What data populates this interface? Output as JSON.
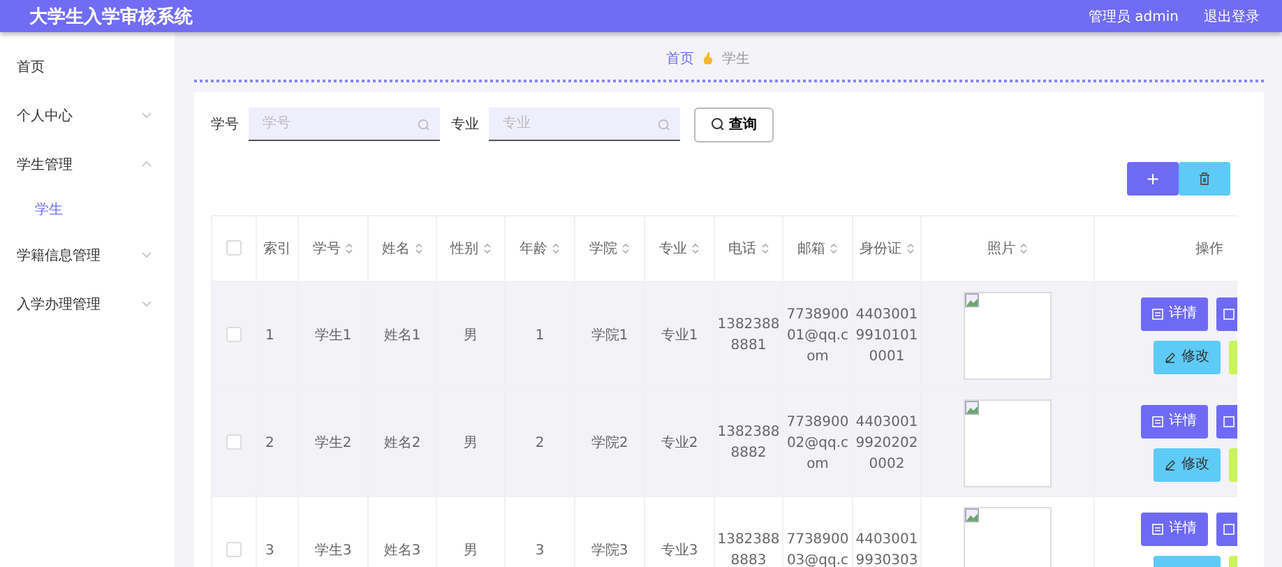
{
  "header": {
    "title": "大学生入学审核系统",
    "user": "管理员 admin",
    "logout": "退出登录"
  },
  "sidebar": {
    "items": [
      {
        "label": "首页",
        "kind": "link"
      },
      {
        "label": "个人中心",
        "kind": "group",
        "expanded": false
      },
      {
        "label": "学生管理",
        "kind": "group",
        "expanded": true,
        "children": [
          {
            "label": "学生",
            "selected": true
          }
        ]
      },
      {
        "label": "学籍信息管理",
        "kind": "group",
        "expanded": false
      },
      {
        "label": "入学办理管理",
        "kind": "group",
        "expanded": false
      }
    ]
  },
  "breadcrumb": [
    {
      "label": "首页",
      "current": false
    },
    {
      "label": "学生",
      "current": true
    }
  ],
  "search": {
    "fields": [
      {
        "label": "学号",
        "placeholder": "学号"
      },
      {
        "label": "专业",
        "placeholder": "专业"
      }
    ],
    "button": "查询"
  },
  "toolbar": {
    "add": "+"
  },
  "table": {
    "select_all_checked": false,
    "columns": [
      {
        "label": "索引",
        "sortable": false
      },
      {
        "label": "学号",
        "sortable": true
      },
      {
        "label": "姓名",
        "sortable": true
      },
      {
        "label": "性别",
        "sortable": true
      },
      {
        "label": "年龄",
        "sortable": true
      },
      {
        "label": "学院",
        "sortable": true
      },
      {
        "label": "专业",
        "sortable": true
      },
      {
        "label": "电话",
        "sortable": true
      },
      {
        "label": "邮箱",
        "sortable": true
      },
      {
        "label": "身份证",
        "sortable": true
      },
      {
        "label": "照片",
        "sortable": true
      },
      {
        "label": "操作",
        "sortable": false
      }
    ],
    "rows": [
      {
        "checked": false,
        "shaded": true,
        "cells": [
          "1",
          "学生1",
          "姓名1",
          "男",
          "1",
          "学院1",
          "专业1",
          "13823888881",
          "773890001@qq.com",
          "440300199101010001"
        ],
        "actions": [
          "详情",
          "修改"
        ]
      },
      {
        "checked": false,
        "shaded": true,
        "cells": [
          "2",
          "学生2",
          "姓名2",
          "男",
          "2",
          "学院2",
          "专业2",
          "13823888882",
          "773890002@qq.com",
          "440300199202020002"
        ],
        "actions": [
          "详情",
          "修改"
        ]
      },
      {
        "checked": false,
        "shaded": false,
        "cells": [
          "3",
          "学生3",
          "姓名3",
          "男",
          "3",
          "学院3",
          "专业3",
          "13823888883",
          "773890003@qq.c",
          "44030019930303"
        ],
        "actions": [
          "详情"
        ]
      }
    ]
  }
}
